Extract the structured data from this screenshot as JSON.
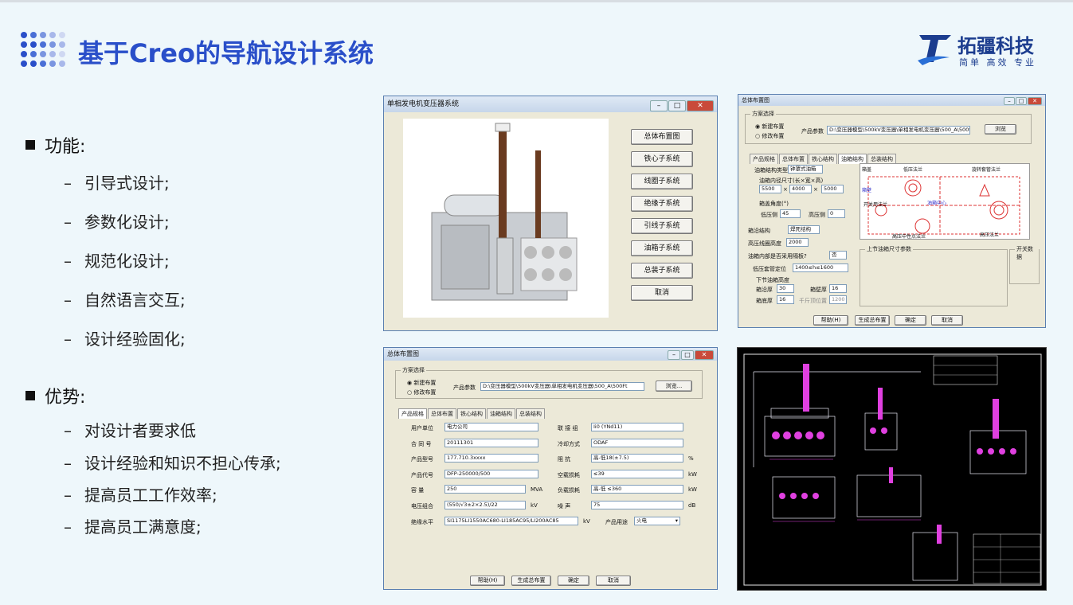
{
  "slide": {
    "title": "基于Creo的导航设计系统",
    "logo": {
      "name": "拓疆科技",
      "slogan": "简单  高效  专业",
      "brand_color": "#1c3d8f"
    },
    "accent_color": "#2a4fc9"
  },
  "features": {
    "heading": "功能:",
    "items": [
      "引导式设计;",
      "参数化设计;",
      "规范化设计;",
      "自然语言交互;",
      "设计经验固化;"
    ]
  },
  "advantages": {
    "heading": "优势:",
    "items": [
      "对设计者要求低",
      "设计经验和知识不担心传承;",
      "提高员工工作效率;",
      "提高员工满意度;"
    ]
  },
  "window1": {
    "title": "单相发电机变压器系统",
    "buttons": [
      "总体布置图",
      "铁心子系统",
      "线圈子系统",
      "绝缘子系统",
      "引线子系统",
      "油箱子系统",
      "总装子系统",
      "取消"
    ]
  },
  "window2": {
    "title": "总体布置图",
    "scheme": {
      "group": "方案选择",
      "new": "新建布置",
      "edit": "修改布置",
      "param_label": "产品参数",
      "param_value": "D:\\变压器模型\\500kV变压器\\单相发电机变压器\\500_A\\500t",
      "browse": "浏览"
    },
    "tabs": [
      "产品规格",
      "总体布置",
      "铁心结构",
      "油箱结构",
      "总装结构"
    ],
    "fields": {
      "tank_type_label": "油箱结构类型",
      "tank_type": "钟罩式油箱",
      "size_label": "油箱内径尺寸(长×宽×高)",
      "size_l": "5500",
      "size_w": "4000",
      "size_h": "5000",
      "angle_label": "箱盖角度(°)",
      "lv_side_label": "低压侧",
      "lv_side": "45",
      "hv_side_label": "高压侧",
      "hv_side": "0",
      "struct_label": "箱沿结构",
      "struct": "焊死结构",
      "hv_height_label": "高压线圈高度",
      "hv_height": "2000",
      "place_label": "油箱内部是否采用隔板?",
      "place": "否",
      "lv_pos_label": "低压套管定位",
      "lv_pos": "1400≤h≤1600",
      "bottom_label": "下节油箱高度",
      "sub1_label": "箱沿厚",
      "sub1": "30",
      "sub2_label": "箱壁厚",
      "sub2": "16",
      "sub3_label": "箱底厚",
      "sub3": "16",
      "sub4_label": "千斤顶位置",
      "sub4": "1200"
    },
    "right_group": "上节油箱尺寸参数",
    "switch_group": "开关数据",
    "diagram_labels": [
      "箱盖",
      "箱壁",
      "低压法兰",
      "旋转套管法兰",
      "开关用法兰",
      "油箱中心",
      "高压中性点法兰",
      "高压法兰"
    ],
    "buttons": [
      "帮助(H)",
      "生成总布置",
      "确定",
      "取消"
    ]
  },
  "window3": {
    "title": "总体布置图",
    "scheme": {
      "group": "方案选择",
      "new": "新建布置",
      "edit": "修改布置",
      "param_label": "产品参数",
      "param_value": "D:\\变压器模型\\500kV变压器\\单相发电机变压器\\500_A\\500Ft",
      "browse": "浏览..."
    },
    "tabs": [
      "产品规格",
      "总体布置",
      "铁心结构",
      "油箱结构",
      "总装结构"
    ],
    "rows": [
      {
        "l1": "用户单位",
        "v1": "电力公司",
        "l2": "联 接 组",
        "v2": "Ii0 (YNd11)",
        "u2": ""
      },
      {
        "l1": "合 同 号",
        "v1": "20111301",
        "l2": "冷却方式",
        "v2": "ODAF",
        "u2": ""
      },
      {
        "l1": "产品型号",
        "v1": "177.710.3xxxx",
        "l2": "阻    抗",
        "v2": "高-低18(±7.5)",
        "u2": "%"
      },
      {
        "l1": "产品代号",
        "v1": "DFP-250000/500",
        "l2": "空载损耗",
        "v2": "≤39",
        "u2": "kW"
      },
      {
        "l1": "容    量",
        "v1": "250",
        "u1": "MVA",
        "l2": "负载损耗",
        "v2": "高-低 ≤360",
        "u2": "kW"
      },
      {
        "l1": "电压组合",
        "v1": "(550/√3±2×2.5)/22",
        "u1": "kV",
        "l2": "噪    声",
        "v2": "75",
        "u2": "dB"
      }
    ],
    "insulation_label": "绝缘水平",
    "insulation": "SI1175LI1550AC680-LI185AC95/LI200AC85",
    "insulation_unit": "kV",
    "usage_label": "产品用途",
    "usage": "火电",
    "buttons": [
      "帮助(H)",
      "生成总布置",
      "确定",
      "取消"
    ]
  }
}
